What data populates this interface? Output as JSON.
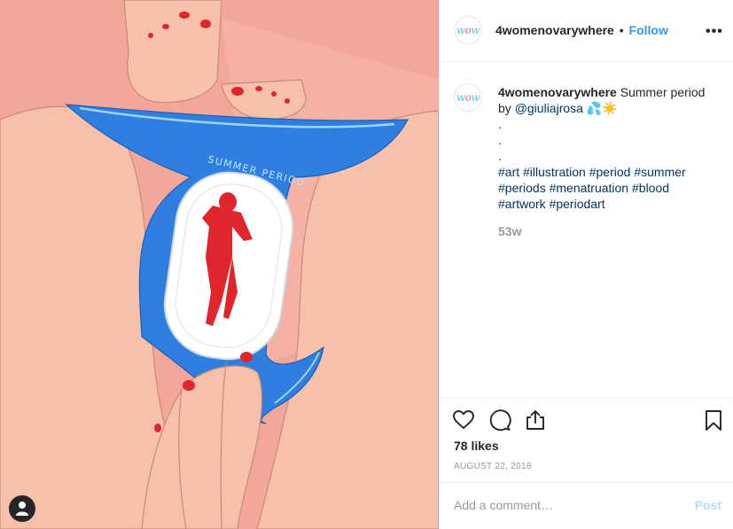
{
  "post": {
    "username": "4womenovarywhere",
    "separator": "•",
    "follow_label": "Follow",
    "more_label": "•••",
    "avatar_text": {
      "left": "w",
      "mid": "o",
      "right": "w"
    },
    "caption": {
      "username": "4womenovarywhere",
      "text": "Summer period",
      "by": "by",
      "mention": "@giuliajrosa",
      "emoji": "💦☀️",
      "dots": [
        ".",
        ".",
        "."
      ],
      "hashtags_line1": [
        "#art",
        "#illustration",
        "#period",
        "#summer"
      ],
      "hashtags_line2": [
        "#periods",
        "#menatruation",
        "#blood"
      ],
      "hashtags_line3": [
        "#artwork",
        "#periodart"
      ]
    },
    "time_ago": "53w",
    "likes": "78 likes",
    "date": "AUGUST 22, 2018",
    "comment_placeholder": "Add a comment…",
    "post_label": "Post",
    "image_text": "SUMMER PERIOD"
  },
  "icons": {
    "like": "heart-icon",
    "comment": "comment-bubble-icon",
    "share": "share-icon",
    "save": "bookmark-icon",
    "tag": "user-tag-icon",
    "more": "more-options-icon"
  },
  "colors": {
    "follow": "#3897f0",
    "hashtag": "#003569",
    "underwear": "#2f7fe0",
    "skin": "#f6c0aa",
    "background": "#f3a79a",
    "nail": "#e0262c"
  }
}
